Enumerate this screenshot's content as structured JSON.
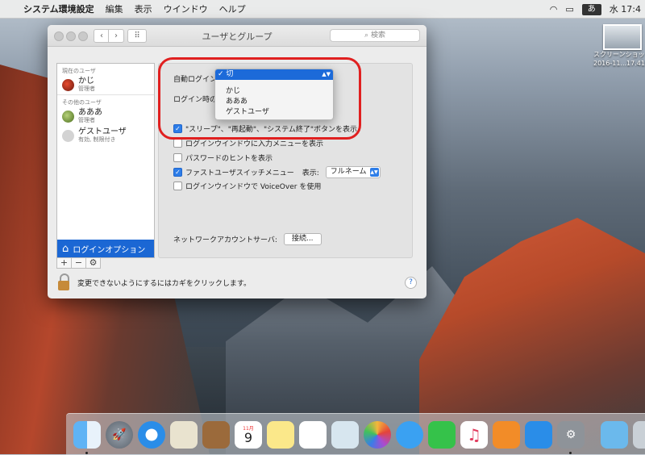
{
  "menubar": {
    "apple": "",
    "app": "システム環境設定",
    "items": [
      "編集",
      "表示",
      "ウインドウ",
      "ヘルプ"
    ],
    "ime": "あ",
    "clock": "水 17:4"
  },
  "desktop_icon": {
    "label1": "スクリーンショット",
    "label2": "2016-11...17.41.4"
  },
  "window": {
    "title": "ユーザとグループ",
    "back": "‹",
    "forward": "›",
    "grid": "⠿",
    "search_placeholder": "検索"
  },
  "sidebar": {
    "current_header": "現在のユーザ",
    "current_user": {
      "name": "かじ",
      "role": "管理者"
    },
    "other_header": "その他のユーザ",
    "others": [
      {
        "name": "あああ",
        "role": "管理者"
      },
      {
        "name": "ゲストユーザ",
        "role": "有効, 制限付き"
      }
    ],
    "login_options": "ログインオプション",
    "add": "+",
    "remove": "−",
    "gear": "⚙"
  },
  "pane": {
    "auto_login_label": "自動ログイン:",
    "display_label": "ログイン時の表",
    "opt_sleep": "\"スリープ\"、\"再起動\"、\"システム終了\"ボタンを表示",
    "opt_input_menu": "ログインウインドウに入力メニューを表示",
    "opt_hint": "パスワードのヒントを表示",
    "opt_fast_switch": "ファストユーザスイッチメニュー",
    "fast_switch_show": "表示:",
    "fast_switch_value": "フルネーム",
    "opt_voiceover": "ログインウインドウで VoiceOver を使用",
    "network_label": "ネットワークアカウントサーバ:",
    "connect_button": "接続..."
  },
  "dropdown": {
    "selected": "✓ 切",
    "options": [
      "かじ",
      "あああ",
      "ゲストユーザ"
    ]
  },
  "footer": {
    "lock_text": "変更できないようにするにはカギをクリックします。",
    "help": "?"
  },
  "dock": {
    "items": [
      "finder-icon",
      "launchpad-icon",
      "safari-icon",
      "mail-icon",
      "notes-book-icon",
      "calendar-icon",
      "notes-icon",
      "reminders-icon",
      "preview-icon",
      "photos-icon",
      "messages-icon",
      "facetime-icon",
      "itunes-icon",
      "ibooks-icon",
      "app-store-icon",
      "system-preferences-icon"
    ],
    "calendar_month": "11月",
    "calendar_day": "9"
  },
  "colors": {
    "accent": "#1b67d4",
    "highlight": "#e02020"
  }
}
